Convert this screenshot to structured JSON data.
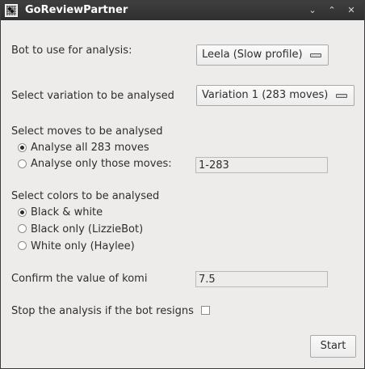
{
  "window": {
    "title": "GoReviewPartner",
    "controls": [
      "chevron-down-icon",
      "chevron-up-icon",
      "close-icon"
    ]
  },
  "bot": {
    "label": "Bot to use for analysis:",
    "selected": "Leela (Slow profile)"
  },
  "variation": {
    "label": "Select variation to be analysed",
    "selected": "Variation 1 (283 moves)"
  },
  "moves": {
    "label": "Select moves to be analysed",
    "options": [
      {
        "label": "Analyse all 283 moves",
        "checked": true
      },
      {
        "label": "Analyse only those moves:",
        "checked": false
      }
    ],
    "range_value": "1-283"
  },
  "colors": {
    "label": "Select colors to be analysed",
    "options": [
      {
        "label": "Black & white",
        "checked": true
      },
      {
        "label": "Black only (LizzieBot)",
        "checked": false
      },
      {
        "label": "White only (Haylee)",
        "checked": false
      }
    ]
  },
  "komi": {
    "label": "Confirm the value of komi",
    "value": "7.5"
  },
  "resign": {
    "label": "Stop the analysis if the bot resigns",
    "checked": false
  },
  "start_button": "Start"
}
